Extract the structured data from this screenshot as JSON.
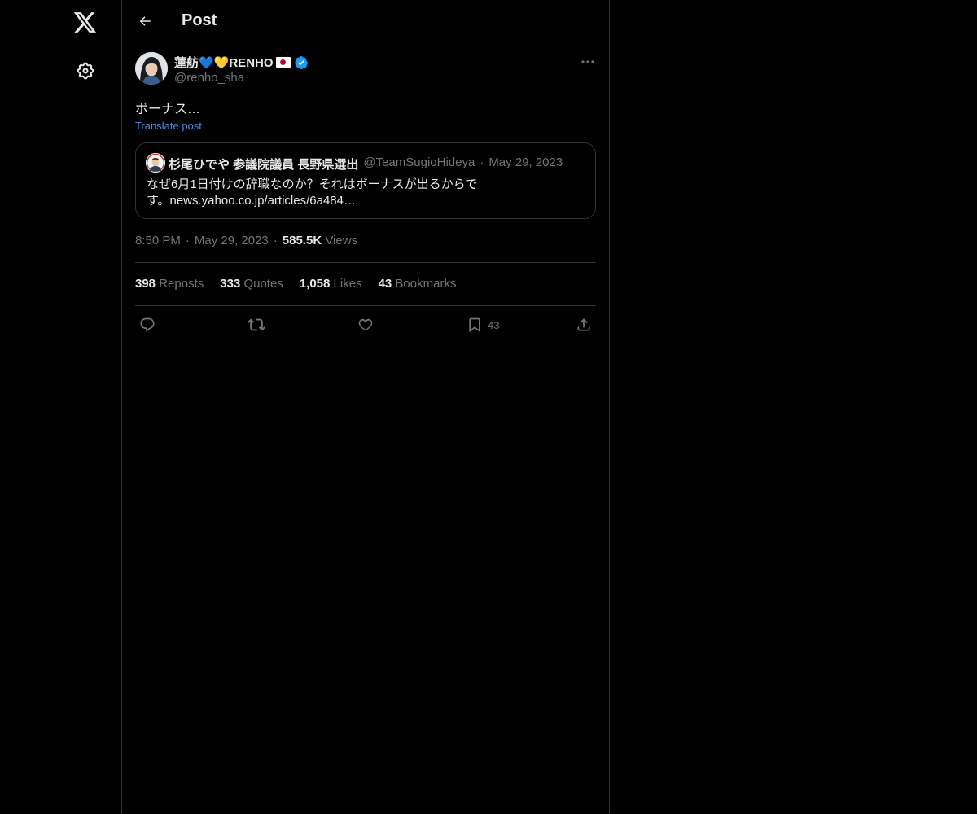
{
  "page": {
    "title": "Post"
  },
  "nav": {
    "logo": "x-logo-icon",
    "settings": "gear-icon"
  },
  "post": {
    "author_name": "蓮舫💙💛RENHO",
    "author_flag": "🇯🇵",
    "handle": "@renho_sha",
    "text": "ボーナス…",
    "translate_label": "Translate post",
    "time": "8:50 PM",
    "date": "May 29, 2023",
    "views_count": "585.5K",
    "views_label": "Views"
  },
  "quote": {
    "name": "杉尾ひでや 参議院議員 長野県選出",
    "handle": "@TeamSugioHideya",
    "date": "May 29, 2023",
    "text": "なぜ6月1日付けの辞職なのか？それはボーナスが出るからです。news.yahoo.co.jp/articles/6a484…"
  },
  "stats": {
    "reposts_count": "398",
    "reposts_label": "Reposts",
    "quotes_count": "333",
    "quotes_label": "Quotes",
    "likes_count": "1,058",
    "likes_label": "Likes",
    "bookmarks_count": "43",
    "bookmarks_label": "Bookmarks"
  },
  "actions": {
    "bookmark_count": "43"
  },
  "colors": {
    "background": "#000000",
    "border": "#2f3336",
    "text": "#e7e9ea",
    "muted": "#71767b",
    "link": "#4a8bd6",
    "verified": "#1d9bf0"
  }
}
